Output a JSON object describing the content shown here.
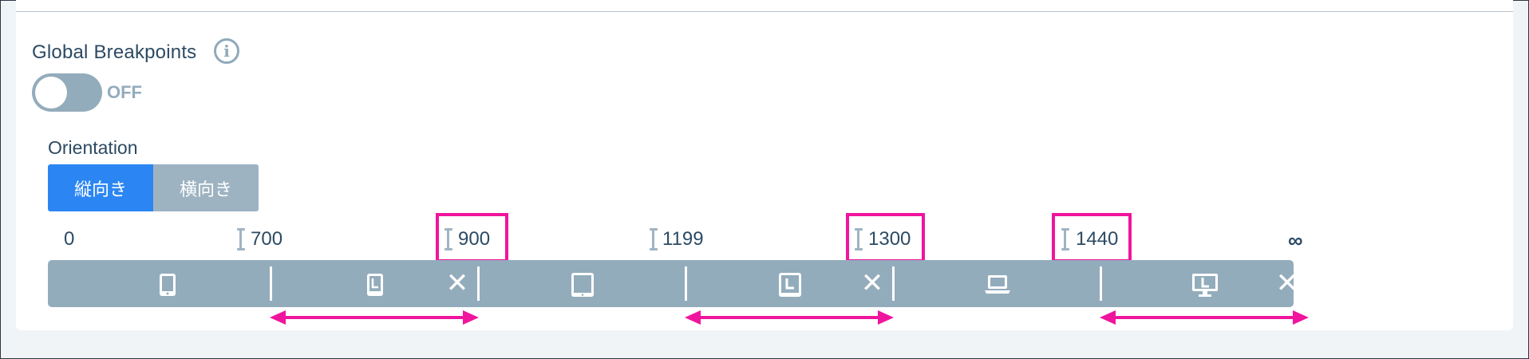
{
  "global_breakpoints": {
    "title": "Global Breakpoints",
    "info_icon": "info-icon",
    "info_glyph": "i",
    "toggle_label": "OFF",
    "toggle_on": false
  },
  "orientation": {
    "title": "Orientation",
    "options": [
      "縦向き",
      "横向き"
    ],
    "selected": "縦向き"
  },
  "scale": {
    "start": "0",
    "end": "∞",
    "breakpoints": [
      "700",
      "900",
      "1199",
      "1300",
      "1440"
    ],
    "highlighted": [
      "900",
      "1300",
      "1440"
    ]
  },
  "bar": {
    "segments": [
      {
        "icon": "phone-portrait-icon"
      },
      {
        "icon": "phone-landscape-icon",
        "removable": true
      },
      {
        "icon": "tablet-portrait-icon"
      },
      {
        "icon": "tablet-landscape-icon",
        "removable": true
      },
      {
        "icon": "laptop-icon"
      },
      {
        "icon": "desktop-landscape-icon",
        "removable": true
      }
    ],
    "close_glyph": "✕"
  },
  "colors": {
    "accent": "#2b86f3",
    "highlight": "#f0159d",
    "bar": "#93acbc",
    "text": "#2c4a63"
  }
}
